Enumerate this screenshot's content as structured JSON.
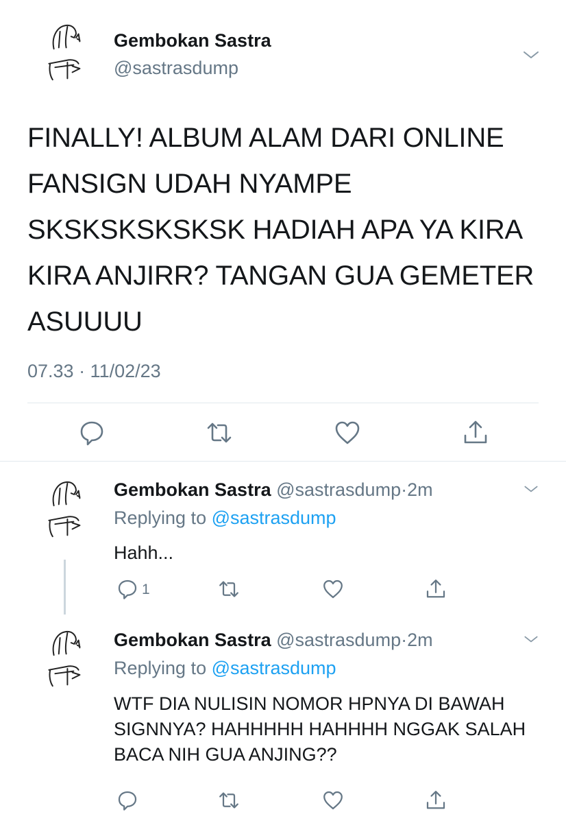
{
  "main_tweet": {
    "display_name": "Gembokan Sastra",
    "handle": "@sastrasdump",
    "text": "FINALLY! ALBUM ALAM DARI ONLINE FANSIGN UDAH NYAMPE SKSKSKSKSKSK HADIAH APA YA KIRA KIRA ANJIRR? TANGAN GUA GEMETER ASUUUU",
    "timestamp": "07.33 · 11/02/23",
    "actions": [
      "reply-icon",
      "retweet-icon",
      "like-icon",
      "share-icon"
    ]
  },
  "replies": [
    {
      "display_name": "Gembokan Sastra",
      "handle": "@sastrasdump",
      "dot": "·",
      "time": "2m",
      "replying_prefix": "Replying to ",
      "replying_mention": "@sastrasdump",
      "text": "Hahh...",
      "reply_count": "1"
    },
    {
      "display_name": "Gembokan Sastra",
      "handle": "@sastrasdump",
      "dot": "·",
      "time": "2m",
      "replying_prefix": "Replying to ",
      "replying_mention": "@sastrasdump",
      "text": "WTF DIA NULISIN NOMOR HPNYA DI BAWAH SIGNNYA? HAHHHHH HAHHHH NGGAK SALAH BACA NIH GUA ANJING??",
      "reply_count": ""
    }
  ],
  "colors": {
    "text": "#14171a",
    "secondary": "#657786",
    "link": "#1da1f2",
    "divider": "#e1e8ed",
    "thread_line": "#ccd6dd"
  }
}
